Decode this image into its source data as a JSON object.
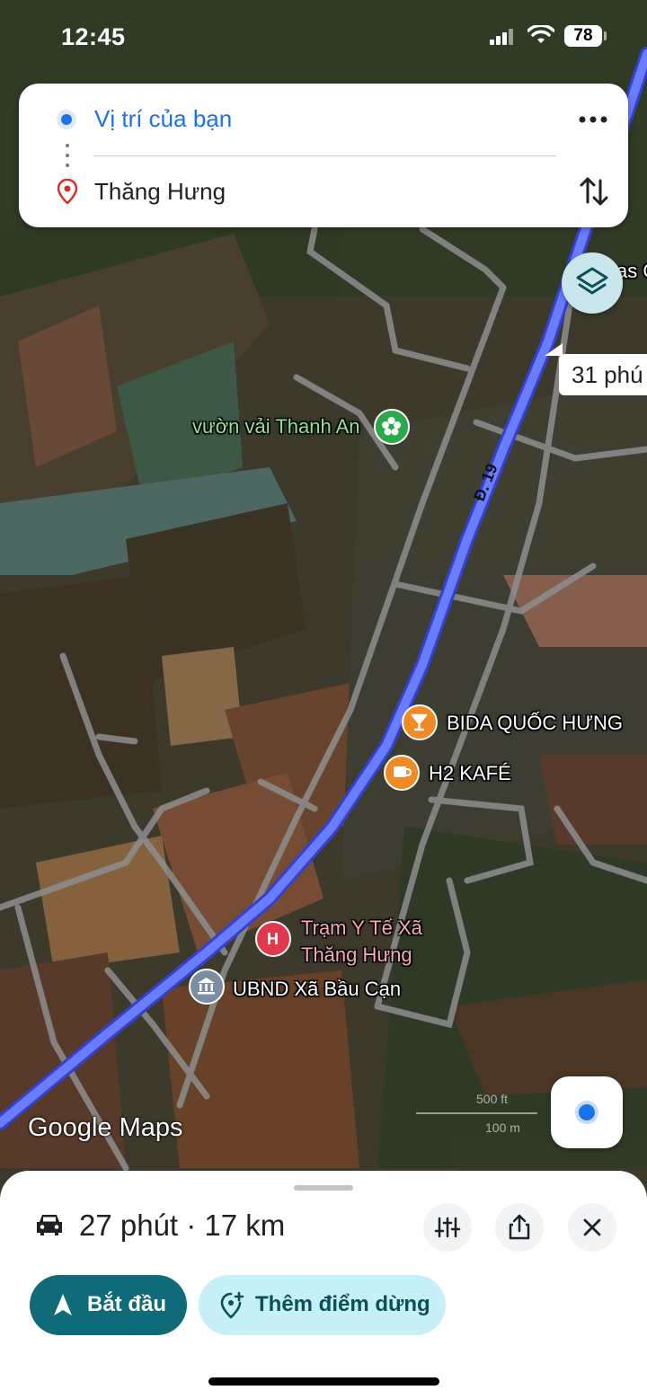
{
  "status_bar": {
    "time": "12:45",
    "battery": "78"
  },
  "directions": {
    "origin": "Vị trí của bạn",
    "destination": "Thăng Hưng",
    "more_icon": "more-horiz-icon",
    "swap_icon": "swap-vertical-icon"
  },
  "map": {
    "eta_bubble": "31 phú",
    "partial_label": "as C",
    "road_name": "Đ. 19",
    "pois": [
      {
        "name": "vườn vải Thanh An",
        "icon": "flower-icon",
        "color": "#2aa84a",
        "text_color": "#8ee58e"
      },
      {
        "name": "BIDA QUỐC HƯNG",
        "icon": "cocktail-icon",
        "color": "#f08a24",
        "text_color": "#ffffff"
      },
      {
        "name": "H2 KAFÉ",
        "icon": "coffee-icon",
        "color": "#f08a24",
        "text_color": "#ffffff"
      },
      {
        "name": "Trạm Y Tế Xã",
        "icon": "hospital-icon",
        "color": "#e2384d",
        "text_color": "#f7a8b4"
      },
      {
        "name": "Thăng Hưng",
        "icon": "",
        "color": "#e2384d",
        "text_color": "#f7a8b4"
      },
      {
        "name": "UBND Xã Bầu Cạn",
        "icon": "government-building-icon",
        "color": "#7b8da0",
        "text_color": "#ffffff"
      }
    ],
    "attribution": "Google Maps",
    "scale_top": "500 ft",
    "scale_bottom": "100 m",
    "route_color": "#5b6ef5"
  },
  "bottom_sheet": {
    "summary": "27 phút · 17 km",
    "start_label": "Bắt đầu",
    "add_stop_label": "Thêm điểm dừng",
    "buttons": [
      "tune-icon",
      "share-icon",
      "close-icon"
    ]
  }
}
